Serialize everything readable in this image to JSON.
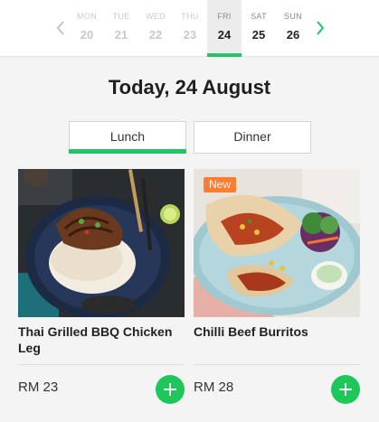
{
  "day_strip": {
    "days": [
      {
        "name": "MON",
        "num": "20"
      },
      {
        "name": "TUE",
        "num": "21"
      },
      {
        "name": "WED",
        "num": "22"
      },
      {
        "name": "THU",
        "num": "23"
      },
      {
        "name": "FRI",
        "num": "24"
      },
      {
        "name": "SAT",
        "num": "25"
      },
      {
        "name": "SUN",
        "num": "26"
      }
    ],
    "active_index": 4,
    "prev_icon": "chevron-left-icon",
    "next_icon": "chevron-right-icon"
  },
  "page_title": "Today, 24 August",
  "meal_tabs": {
    "lunch_label": "Lunch",
    "dinner_label": "Dinner",
    "active": "lunch"
  },
  "meals": [
    {
      "title": "Thai Grilled BBQ Chicken Leg",
      "price": "RM 23",
      "badge": null,
      "add_icon": "plus-icon"
    },
    {
      "title": "Chilli Beef Burritos",
      "price": "RM 28",
      "badge": "New",
      "add_icon": "plus-icon"
    }
  ],
  "colors": {
    "accent_green": "#22c463",
    "badge_orange": "#ff7b2e",
    "add_button_green": "#1ec75a"
  }
}
